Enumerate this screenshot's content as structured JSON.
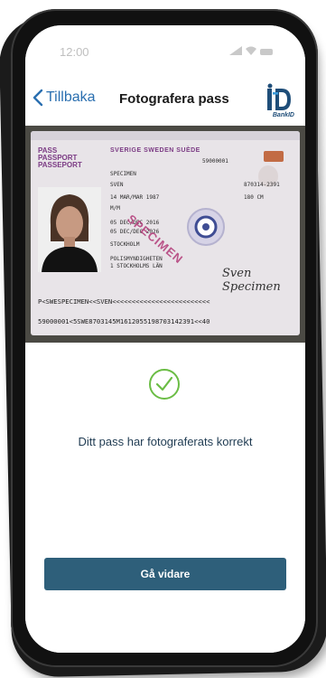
{
  "status_bar": {
    "time": "12:00"
  },
  "nav": {
    "back_label": "Tillbaka",
    "title": "Fotografera pass",
    "brand_text": "BankID"
  },
  "passport": {
    "doc_type_lines": [
      "PASS",
      "PASSPORT",
      "PASSEPORT"
    ],
    "country_line": "SVERIGE  SWEDEN  SUÈDE",
    "fields": [
      "SPECIMEN",
      "SVEN",
      "14 MAR/MAR 1987",
      "M/M",
      "05 DEC/DEC 2016",
      "05 DEC/DEC 2026",
      "STOCKHOLM",
      "POLISMYNDIGHETEN",
      "1 STOCKHOLMS LÄN"
    ],
    "document_number": "59000001",
    "right_fields": [
      "870314-2391",
      "180 CM"
    ],
    "watermark": "SPECIMEN",
    "signature": "Sven Specimen",
    "mrz_line_1": "P<SWESPECIMEN<<SVEN<<<<<<<<<<<<<<<<<<<<<<<<<",
    "mrz_line_2": "59000001<5SWE8703145M1612055198703142391<<40"
  },
  "result": {
    "status_icon": "check-circle-icon",
    "message": "Ditt pass har fotograferats korrekt",
    "accent_color": "#6bbd45"
  },
  "actions": {
    "continue_label": "Gå vidare",
    "button_color": "#2e5f7a"
  }
}
